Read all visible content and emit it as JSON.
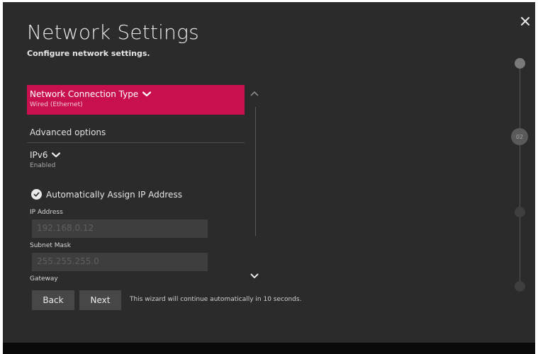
{
  "header": {
    "title": "Network Settings",
    "subtitle": "Configure network settings."
  },
  "connection_type": {
    "label": "Network Connection Type",
    "value": "Wired (Ethernet)"
  },
  "advanced": {
    "heading": "Advanced options"
  },
  "ipv6": {
    "label": "IPv6",
    "value": "Enabled"
  },
  "auto_ip": {
    "label": "Automatically Assign IP Address",
    "checked": true
  },
  "fields": {
    "ip_address": {
      "label": "IP Address",
      "value": "192.168.0.12"
    },
    "subnet_mask": {
      "label": "Subnet Mask",
      "value": "255.255.255.0"
    },
    "gateway": {
      "label": "Gateway"
    }
  },
  "footer": {
    "back_label": "Back",
    "next_label": "Next",
    "wizard_note": "This wizard will continue automatically in 10 seconds."
  },
  "steps": {
    "current": "02"
  },
  "icons": {
    "close": "close-icon",
    "chevron_down": "chevron-down-icon",
    "chevron_up": "chevron-up-icon",
    "check": "check-icon"
  },
  "colors": {
    "background": "#2b2b2b",
    "accent": "#c8104f",
    "field_bg": "#3e3e3e",
    "button_bg": "#474747"
  }
}
